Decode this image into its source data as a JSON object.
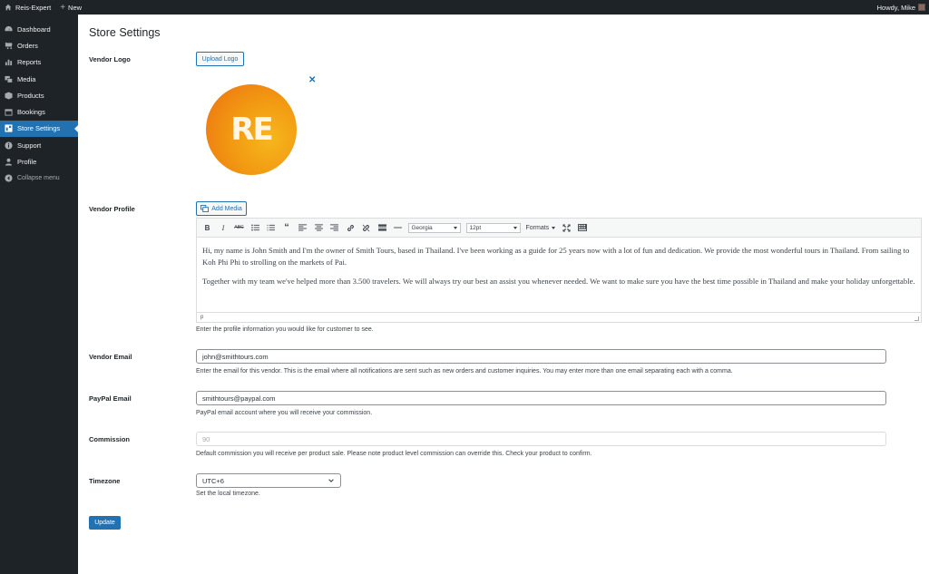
{
  "adminbar": {
    "site_name": "Reis-Expert",
    "new_label": "New",
    "howdy": "Howdy, Mike"
  },
  "sidebar": {
    "items": [
      {
        "label": "Dashboard",
        "icon": "dashboard-icon"
      },
      {
        "label": "Orders",
        "icon": "cart-icon"
      },
      {
        "label": "Reports",
        "icon": "chart-bar-icon"
      },
      {
        "label": "Media",
        "icon": "media-icon"
      },
      {
        "label": "Products",
        "icon": "box-icon"
      },
      {
        "label": "Bookings",
        "icon": "calendar-icon"
      },
      {
        "label": "Store Settings",
        "icon": "store-icon",
        "active": true
      },
      {
        "label": "Support",
        "icon": "info-icon"
      },
      {
        "label": "Profile",
        "icon": "user-icon"
      }
    ],
    "collapse_label": "Collapse menu"
  },
  "page": {
    "title": "Store Settings"
  },
  "vendor_logo": {
    "label": "Vendor Logo",
    "upload_button": "Upload Logo",
    "remove_symbol": "✕",
    "logo_text": "RE"
  },
  "vendor_profile": {
    "label": "Vendor Profile",
    "add_media_button": "Add Media",
    "font_family": "Georgia",
    "font_size": "12pt",
    "formats_label": "Formats",
    "paragraphs": [
      "Hi, my name is John Smith and I'm the owner of Smith Tours, based in Thailand. I've been working as a guide for 25 years now with a lot of fun and dedication. We provide the most wonderful tours in Thailand. From sailing to Koh Phi Phi to strolling on the markets of Pai.",
      "Together with my team we've helped more than 3.500 travelers. We will always try our best an assist you whenever needed. We want to make sure you have the best time possible in Thailand and make your holiday unforgettable."
    ],
    "status_path": "p",
    "description": "Enter the profile information you would like for customer to see."
  },
  "vendor_email": {
    "label": "Vendor Email",
    "value": "john@smithtours.com",
    "description": "Enter the email for this vendor. This is the email where all notifications are sent such as new orders and customer inquiries. You may enter more than one email separating each with a comma."
  },
  "paypal_email": {
    "label": "PayPal Email",
    "value": "smithtours@paypal.com",
    "description": "PayPal email account where you will receive your commission."
  },
  "commission": {
    "label": "Commission",
    "value": "90",
    "description": "Default commission you will receive per product sale. Please note product level commission can override this. Check your product to confirm."
  },
  "timezone": {
    "label": "Timezone",
    "value": "UTC+6",
    "description": "Set the local timezone."
  },
  "update_button": "Update",
  "colors": {
    "accent": "#2271b1",
    "sidebar_bg": "#1d2327",
    "logo_orange": "#ec6f12",
    "logo_yellow": "#f6b71c"
  }
}
